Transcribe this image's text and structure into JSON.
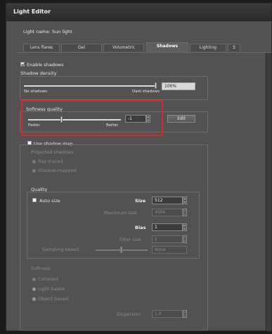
{
  "window": {
    "title": "Light Editor"
  },
  "light_name": "Light name: Sun light",
  "tabs": [
    {
      "label": "Lens flares",
      "active": false
    },
    {
      "label": "Gel",
      "active": false
    },
    {
      "label": "Volumetric",
      "active": false
    },
    {
      "label": "Shadows",
      "active": true
    },
    {
      "label": "Lighting",
      "active": false
    },
    {
      "label": "S",
      "active": false
    }
  ],
  "shadows": {
    "enable_label": "Enable shadows",
    "enable_checked": true,
    "density": {
      "label": "Shadow density",
      "min_label": "No shadows",
      "max_label": "Dark shadows",
      "value": "100%",
      "level": 1.0
    },
    "softness": {
      "label": "Softness quality",
      "min_label": "Faster",
      "max_label": "Better",
      "value": "-1",
      "edit_label": "Edit",
      "level": 0.35
    },
    "shadow_map": {
      "use_label": "Use shadow map",
      "use_checked": false,
      "projected_label": "Projected shadows",
      "options": [
        "Ray-traced",
        "Shadow-mapped"
      ],
      "quality": {
        "label": "Quality",
        "auto_size_label": "Auto size",
        "auto_size_checked": true,
        "size_label": "Size",
        "size_value": "512",
        "max_size_label": "Maximum size",
        "max_size_value": "4096",
        "bias_label": "Bias",
        "bias_value": "1",
        "filter_size_label": "Filter size",
        "filter_size_value": "2",
        "sampling_label": "Sampling based",
        "sampling_value": "None",
        "sampling_level": 0.5
      },
      "softness": {
        "label": "Softness",
        "options": [
          "Constant",
          "Light based",
          "Object based"
        ],
        "dispersion_label": "Dispersion",
        "dispersion_value": "1.0"
      }
    }
  }
}
